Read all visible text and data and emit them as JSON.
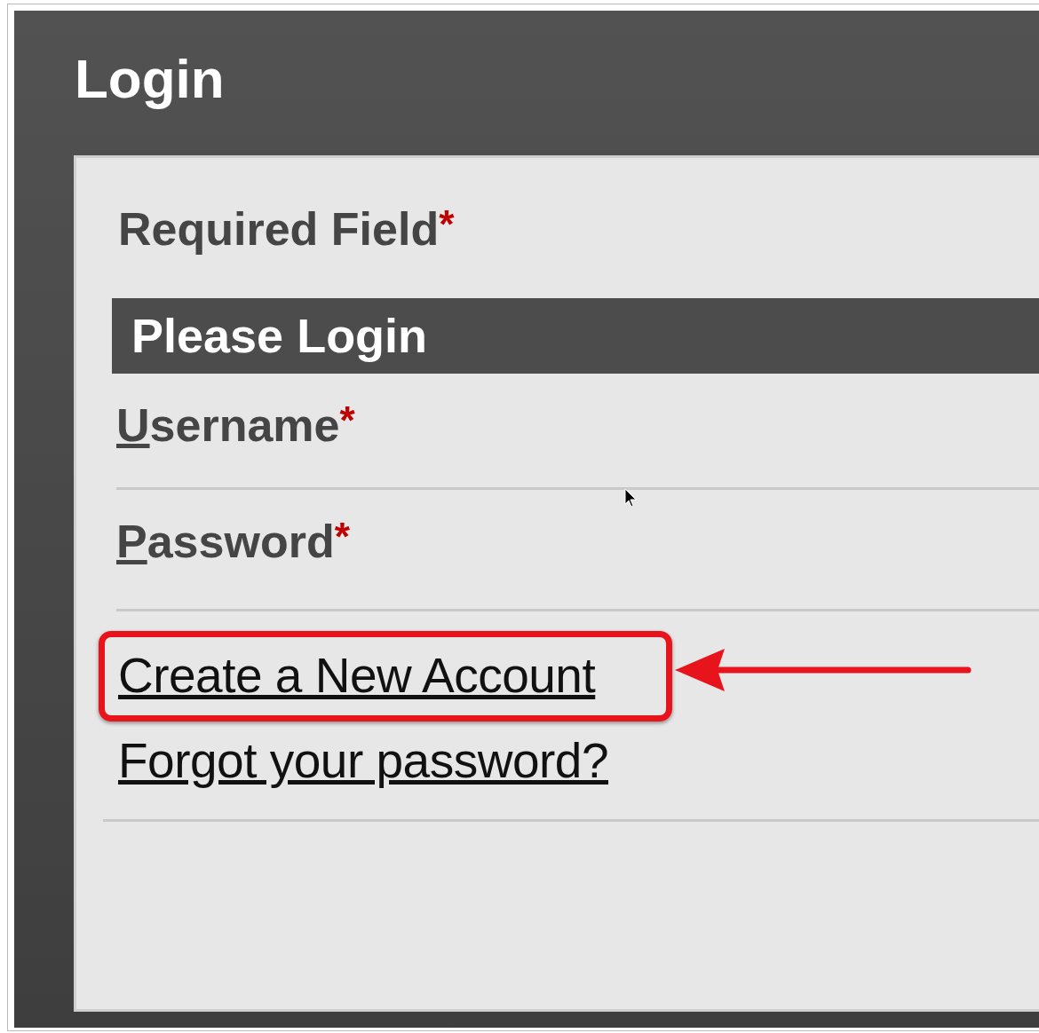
{
  "window": {
    "title": "Login"
  },
  "required_note": {
    "text": "Required Field",
    "required_mark": "*"
  },
  "section": {
    "title": "Please Login"
  },
  "fields": [
    {
      "access_key": "U",
      "label_rest": "sername",
      "required_mark": "*"
    },
    {
      "access_key": "P",
      "label_rest": "assword",
      "required_mark": "*"
    }
  ],
  "links": [
    {
      "text": "Create a New Account",
      "highlighted": true
    },
    {
      "text": "Forgot your password?",
      "highlighted": false
    }
  ]
}
